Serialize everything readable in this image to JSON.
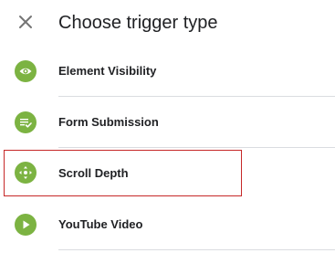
{
  "header": {
    "title": "Choose trigger type",
    "close_icon": "close-icon"
  },
  "colors": {
    "icon_background": "#7cb342",
    "selection_outline": "#c62828",
    "divider": "#dadce0"
  },
  "items": [
    {
      "label": "Element Visibility",
      "icon": "eye-icon"
    },
    {
      "label": "Form Submission",
      "icon": "form-submit-icon"
    },
    {
      "label": "Scroll Depth",
      "icon": "scroll-move-icon",
      "selected": true
    },
    {
      "label": "YouTube Video",
      "icon": "play-icon"
    }
  ]
}
